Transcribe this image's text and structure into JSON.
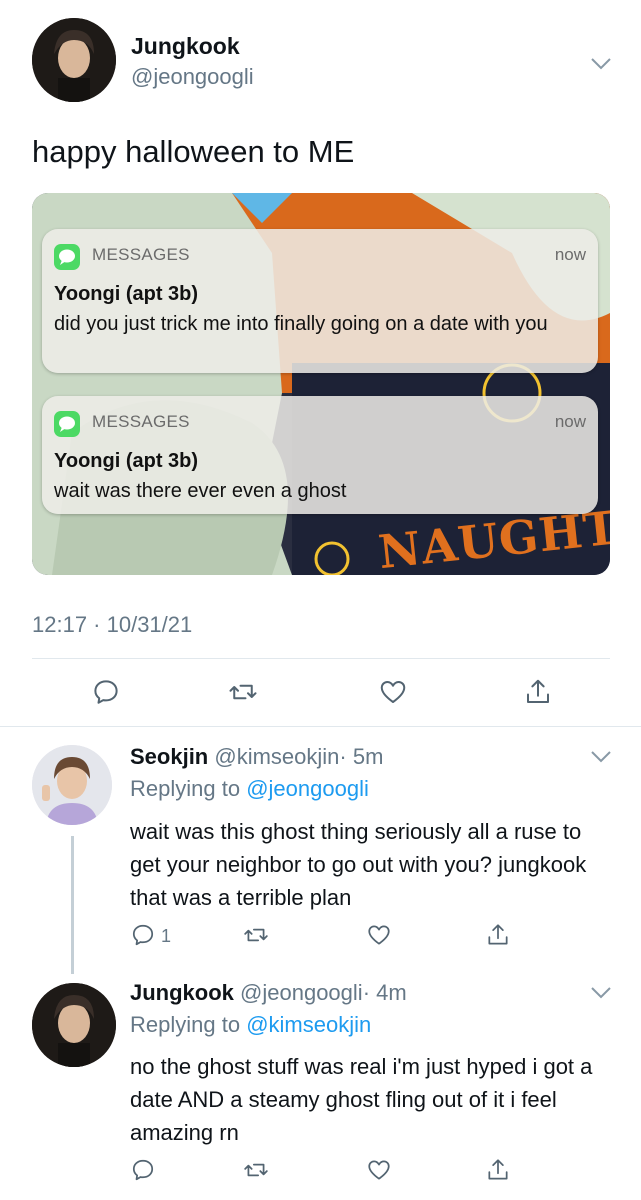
{
  "main_tweet": {
    "name": "Jungkook",
    "handle": "@jeongoogli",
    "text": "happy halloween to ME",
    "timestamp": "12:17 · 10/31/21",
    "notifications": [
      {
        "app": "MESSAGES",
        "time": "now",
        "sender": "Yoongi (apt 3b)",
        "message": "did you just trick me into finally going on a date with you"
      },
      {
        "app": "MESSAGES",
        "time": "now",
        "sender": "Yoongi (apt 3b)",
        "message": "wait was there ever even a ghost"
      }
    ],
    "image_overlay_text": "NAUGHTY"
  },
  "reply1": {
    "name": "Seokjin",
    "handle": "@kimseokjin",
    "time": "· 5m",
    "replying_prefix": "Replying to",
    "replying_to": "@jeongoogli",
    "text": "wait was this ghost thing seriously all a ruse to get your neighbor to go out with you? jungkook that was a terrible plan",
    "reply_count": "1"
  },
  "reply2": {
    "name": "Jungkook",
    "handle": "@jeongoogli",
    "time": "· 4m",
    "replying_prefix": "Replying to",
    "replying_to": "@kimseokjin",
    "text": "no the ghost stuff was real i'm just hyped i got a date AND a steamy ghost fling out of it i feel amazing rn"
  },
  "icons": [
    "reply-icon",
    "retweet-icon",
    "like-icon",
    "share-icon",
    "chevron-down-icon"
  ],
  "colors": {
    "link": "#1d9bf0",
    "muted": "#657786",
    "messages_green": "#4cd964",
    "image_orange": "#e0701e"
  }
}
